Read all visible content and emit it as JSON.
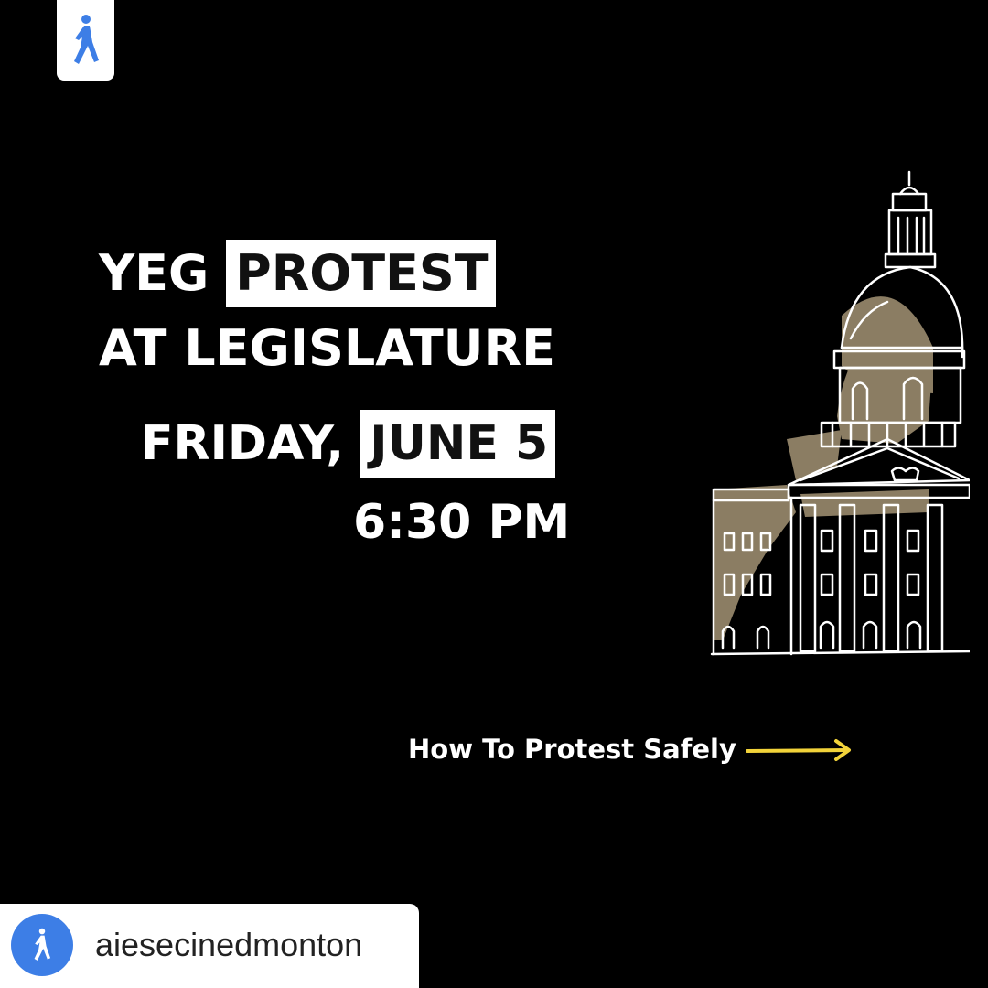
{
  "headline": {
    "line1_plain": "YEG ",
    "line1_highlight": "PROTEST",
    "line2": "AT LEGISLATURE",
    "line3_plain": "FRIDAY, ",
    "line3_highlight": "JUNE 5",
    "line4": "6:30 PM"
  },
  "cta": {
    "label": "How To Protest Safely",
    "arrow_icon": "arrow-right-icon"
  },
  "account": {
    "username": "aiesecinedmonton",
    "avatar_icon": "walking-person-icon"
  },
  "logo": {
    "icon": "walking-person-icon"
  },
  "colors": {
    "background": "#000000",
    "text": "#ffffff",
    "highlight_bg": "#ffffff",
    "highlight_text": "#111111",
    "arrow": "#f2d33a",
    "brand_blue": "#3d7ee6",
    "building_fill": "#8b7d63"
  }
}
